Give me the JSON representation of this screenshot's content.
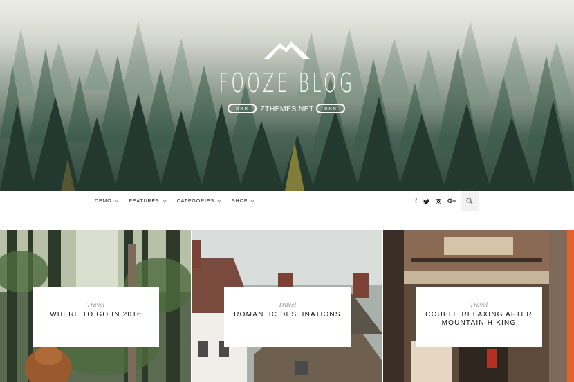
{
  "header": {
    "site_title": "FOOZE BLOG",
    "site_url": "ZTHEMES.NET",
    "badge_left": "×××",
    "badge_right": "×××",
    "logo_icon": "mountain-icon"
  },
  "nav": {
    "items": [
      {
        "label": "DEMO",
        "has_dropdown": true
      },
      {
        "label": "FEATURES",
        "has_dropdown": true
      },
      {
        "label": "CATEGORIES",
        "has_dropdown": true
      },
      {
        "label": "SHOP",
        "has_dropdown": true
      }
    ],
    "social": [
      {
        "icon": "facebook-icon",
        "glyph": "f"
      },
      {
        "icon": "twitter-icon",
        "glyph": "🐦"
      },
      {
        "icon": "instagram-icon",
        "glyph": "◎"
      },
      {
        "icon": "google-plus-icon",
        "glyph": "G+"
      }
    ],
    "search_icon": "search-icon"
  },
  "posts": [
    {
      "category": "Travel",
      "title": "WHERE TO GO IN 2016"
    },
    {
      "category": "Travel",
      "title": "ROMANTIC DESTINATIONS"
    },
    {
      "category": "Travel",
      "title": "COUPLE RELAXING AFTER MOUNTAIN HIKING"
    }
  ],
  "colors": {
    "accent": "#f26c2a",
    "text": "#111111",
    "muted": "#8a8a8a"
  }
}
